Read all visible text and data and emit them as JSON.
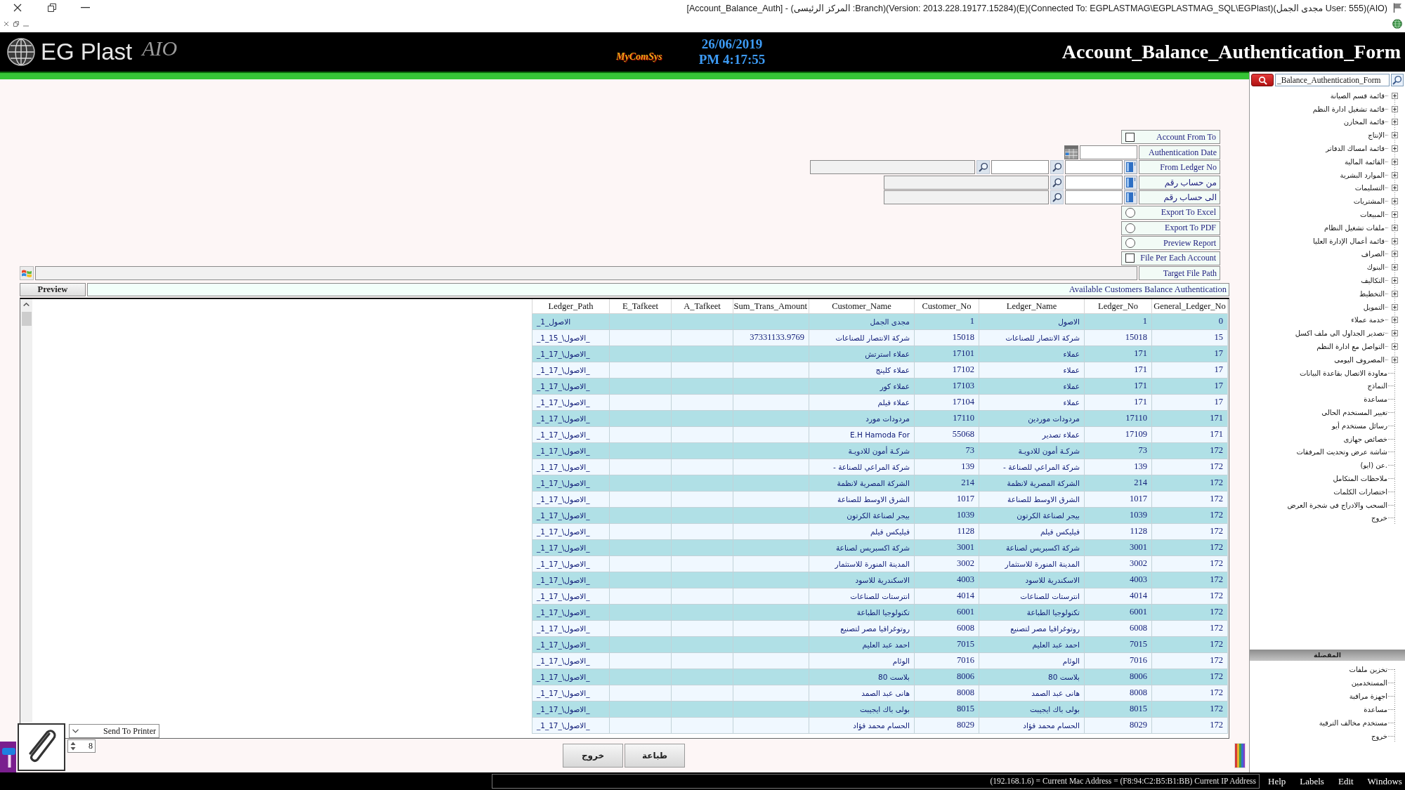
{
  "title_bar": {
    "title": "[Account_Balance_Auth] - (المركز الرئيسى :Branch)(Version: 2013.228.19177.15284)(E)(Connected To: EGPLASTMAG\\EGPLASTMAG_SQL\\EGPlast)(مجدى الجمل User: 555)(AIO)"
  },
  "header": {
    "brand": "EG Plast",
    "brand_suffix": "AIO",
    "vendor": "MyComSys",
    "date": "26/06/2019",
    "time": "PM 4:17:55",
    "form_title": "Account_Balance_Authentication_Form"
  },
  "form": {
    "rows": [
      {
        "kind": "checkbox",
        "label": "Account From To",
        "checked": false
      },
      {
        "kind": "date",
        "label": "Authentication Date"
      },
      {
        "kind": "multilookup",
        "label": "From Ledger No"
      },
      {
        "kind": "lookup",
        "label": "من حساب رقم"
      },
      {
        "kind": "lookup",
        "label": "الى حساب رقم"
      },
      {
        "kind": "radio",
        "label": "Export To Excel",
        "selected": false
      },
      {
        "kind": "radio",
        "label": "Export To PDF",
        "selected": false
      },
      {
        "kind": "radio",
        "label": "Preview Report",
        "selected": false
      },
      {
        "kind": "checkbox",
        "label": "File Per Each Account",
        "checked": false
      },
      {
        "kind": "path",
        "label": "Target File Path"
      }
    ]
  },
  "report": {
    "preview_button": "Preview",
    "caption": "Available Customers Balance Authentication",
    "columns": [
      "General_Ledger_No",
      "Ledger_No",
      "Ledger_Name",
      "Customer_No",
      "Customer_Name",
      "Sum_Trans_Amount",
      "A_Tafkeet",
      "E_Tafkeet",
      "Ledger_Path"
    ],
    "rows": [
      {
        "general_ledger_no": "0",
        "ledger_no": "1",
        "ledger_name": "الاصول",
        "customer_no": "1",
        "customer_name": "مجدى الجمل",
        "ledger_path": "_1_الاصول"
      },
      {
        "general_ledger_no": "15",
        "ledger_no": "15018",
        "ledger_name": "شركة الانتصار للصناعات",
        "customer_no": "15018",
        "customer_name": "شركة الانتصار للصناعات",
        "sum_trans_amount": "37331133.9769",
        "ledger_path": "_1_الاصول\\_15_"
      },
      {
        "general_ledger_no": "17",
        "ledger_no": "171",
        "ledger_name": "عملاء",
        "customer_no": "17101",
        "customer_name": "عملاء استرتش",
        "ledger_path": "_1_الاصول\\_17_"
      },
      {
        "general_ledger_no": "17",
        "ledger_no": "171",
        "ledger_name": "عملاء",
        "customer_no": "17102",
        "customer_name": "عملاء كلينج",
        "ledger_path": "_1_الاصول\\_17_"
      },
      {
        "general_ledger_no": "17",
        "ledger_no": "171",
        "ledger_name": "عملاء",
        "customer_no": "17103",
        "customer_name": "عملاء كور",
        "ledger_path": "_1_الاصول\\_17_"
      },
      {
        "general_ledger_no": "17",
        "ledger_no": "171",
        "ledger_name": "عملاء",
        "customer_no": "17104",
        "customer_name": "عملاء فيلم",
        "ledger_path": "_1_الاصول\\_17_"
      },
      {
        "general_ledger_no": "171",
        "ledger_no": "17110",
        "ledger_name": "مردودات موردين",
        "customer_no": "17110",
        "customer_name": "مردودات مورد",
        "ledger_path": "_1_الاصول\\_17_"
      },
      {
        "general_ledger_no": "171",
        "ledger_no": "17109",
        "ledger_name": "عملاء تصدير",
        "customer_no": "55068",
        "customer_name": "E.H Hamoda For",
        "ledger_path": "_1_الاصول\\_17_"
      },
      {
        "general_ledger_no": "172",
        "ledger_no": "73",
        "ledger_name": "شركـة أمون للادويـة",
        "customer_no": "73",
        "customer_name": "شركـة أمون للادويـة",
        "ledger_path": "_1_الاصول\\_17_"
      },
      {
        "general_ledger_no": "172",
        "ledger_no": "139",
        "ledger_name": "شركة المراعي للصناعة -",
        "customer_no": "139",
        "customer_name": "شركة المراعي للصناعة -",
        "ledger_path": "_1_الاصول\\_17_"
      },
      {
        "general_ledger_no": "172",
        "ledger_no": "214",
        "ledger_name": "الشركة المصرية لانظمة",
        "customer_no": "214",
        "customer_name": "الشركة المصرية لانظمة",
        "ledger_path": "_1_الاصول\\_17_"
      },
      {
        "general_ledger_no": "172",
        "ledger_no": "1017",
        "ledger_name": "الشرق الاوسط للصناعة",
        "customer_no": "1017",
        "customer_name": "الشرق الاوسط للصناعة",
        "ledger_path": "_1_الاصول\\_17_"
      },
      {
        "general_ledger_no": "172",
        "ledger_no": "1039",
        "ledger_name": "بيجر لصناعة الكرتون",
        "customer_no": "1039",
        "customer_name": "بيجر لصناعة الكرتون",
        "ledger_path": "_1_الاصول\\_17_"
      },
      {
        "general_ledger_no": "172",
        "ledger_no": "1128",
        "ledger_name": "فيليكس فيلم",
        "customer_no": "1128",
        "customer_name": "فيليكس فيلم",
        "ledger_path": "_1_الاصول\\_17_"
      },
      {
        "general_ledger_no": "172",
        "ledger_no": "3001",
        "ledger_name": "شركة اكسبريس لصناعة",
        "customer_no": "3001",
        "customer_name": "شركة اكسبريس لصناعة",
        "ledger_path": "_1_الاصول\\_17_"
      },
      {
        "general_ledger_no": "172",
        "ledger_no": "3002",
        "ledger_name": "المدينة المنورة للاستثمار",
        "customer_no": "3002",
        "customer_name": "المدينة المنورة للاستثمار",
        "ledger_path": "_1_الاصول\\_17_"
      },
      {
        "general_ledger_no": "172",
        "ledger_no": "4003",
        "ledger_name": "الاسكندرية للاسود",
        "customer_no": "4003",
        "customer_name": "الاسكندرية للاسود",
        "ledger_path": "_1_الاصول\\_17_"
      },
      {
        "general_ledger_no": "172",
        "ledger_no": "4014",
        "ledger_name": "انترستات للصناعات",
        "customer_no": "4014",
        "customer_name": "انترستات للصناعات",
        "ledger_path": "_1_الاصول\\_17_"
      },
      {
        "general_ledger_no": "172",
        "ledger_no": "6001",
        "ledger_name": "تكنولوجيا الطباعة",
        "customer_no": "6001",
        "customer_name": "تكنولوجيا الطباعة",
        "ledger_path": "_1_الاصول\\_17_"
      },
      {
        "general_ledger_no": "172",
        "ledger_no": "6008",
        "ledger_name": "روتوغرافيا مصر لتصنيع",
        "customer_no": "6008",
        "customer_name": "روتوغرافيا مصر لتصنيع",
        "ledger_path": "_1_الاصول\\_17_"
      },
      {
        "general_ledger_no": "172",
        "ledger_no": "7015",
        "ledger_name": "احمد عبد العليم",
        "customer_no": "7015",
        "customer_name": "احمد عبد العليم",
        "ledger_path": "_1_الاصول\\_17_"
      },
      {
        "general_ledger_no": "172",
        "ledger_no": "7016",
        "ledger_name": "الوئام",
        "customer_no": "7016",
        "customer_name": "الوئام",
        "ledger_path": "_1_الاصول\\_17_"
      },
      {
        "general_ledger_no": "172",
        "ledger_no": "8006",
        "ledger_name": "بلاست 80",
        "customer_no": "8006",
        "customer_name": "بلاست 80",
        "ledger_path": "_1_الاصول\\_17_"
      },
      {
        "general_ledger_no": "172",
        "ledger_no": "8008",
        "ledger_name": "هانى عبد الصمد",
        "customer_no": "8008",
        "customer_name": "هانى عبد الصمد",
        "ledger_path": "_1_الاصول\\_17_"
      },
      {
        "general_ledger_no": "172",
        "ledger_no": "8015",
        "ledger_name": "بولى باك ايجيبت",
        "customer_no": "8015",
        "customer_name": "بولى باك ايجيبت",
        "ledger_path": "_1_الاصول\\_17_"
      },
      {
        "general_ledger_no": "172",
        "ledger_no": "8029",
        "ledger_name": "الحسام محمد فؤاد",
        "customer_no": "8029",
        "customer_name": "الحسام محمد فؤاد",
        "ledger_path": "_1_الاصول\\_17_"
      }
    ]
  },
  "footer": {
    "printer": "Send To Printer",
    "copies": "8",
    "buttons": [
      "طباعة",
      "خروج"
    ]
  },
  "sidebar": {
    "search": {
      "value": "_Balance_Authentication_Form"
    },
    "tree": [
      {
        "kind": "group",
        "label": "قائمة قسم الصيانة",
        "expanded": false
      },
      {
        "kind": "group",
        "label": "قائمة تشغيل ادارة النظم",
        "expanded": false
      },
      {
        "kind": "group",
        "label": "قائمة المخازن",
        "expanded": false
      },
      {
        "kind": "group",
        "label": "الإنتاج",
        "expanded": false
      },
      {
        "kind": "group",
        "label": "قائمة امساك الدفاتر",
        "expanded": false
      },
      {
        "kind": "group",
        "label": "القائمة المالية",
        "expanded": false
      },
      {
        "kind": "group",
        "label": "الموارد البشرية",
        "expanded": false
      },
      {
        "kind": "group",
        "label": "التسليمات",
        "expanded": false
      },
      {
        "kind": "group",
        "label": "المشتريات",
        "expanded": false
      },
      {
        "kind": "group",
        "label": "المبيعات",
        "expanded": false
      },
      {
        "kind": "group",
        "label": "ملفات تشغيل النظام",
        "expanded": false
      },
      {
        "kind": "group",
        "label": "قائمة أعمال الإدارة العليا",
        "expanded": false
      },
      {
        "kind": "group",
        "label": "الصراف",
        "expanded": false
      },
      {
        "kind": "group",
        "label": "البنوك",
        "expanded": false
      },
      {
        "kind": "group",
        "label": "التكاليف",
        "expanded": false
      },
      {
        "kind": "group",
        "label": "التخطيط",
        "expanded": false
      },
      {
        "kind": "group",
        "label": "التمويل",
        "expanded": false
      },
      {
        "kind": "group",
        "label": "خدمة عملاء",
        "expanded": false
      },
      {
        "kind": "group",
        "label": "تصدير الجداول الى ملف اكسل",
        "expanded": false
      },
      {
        "kind": "group",
        "label": "التواصل مع ادارة النظم",
        "expanded": false
      },
      {
        "kind": "group",
        "label": "المصروف اليومى",
        "expanded": false
      },
      {
        "kind": "item",
        "label": "معاودة الاتصال بقاعدة البيانات"
      },
      {
        "kind": "item",
        "label": "النماذج"
      },
      {
        "kind": "item",
        "label": "مساعدة"
      },
      {
        "kind": "item",
        "label": "تغيير المستخدم الحالى"
      },
      {
        "kind": "item",
        "label": "رسائل مستخدم أيو"
      },
      {
        "kind": "item",
        "label": "خصائص جهازى"
      },
      {
        "kind": "item",
        "label": "شاشة عرض وتحديث المرفقات"
      },
      {
        "kind": "item",
        "label": "عن (ايو)."
      },
      {
        "kind": "item",
        "label": "ملاحظات المتكامل"
      },
      {
        "kind": "item",
        "label": "اختصارات الكلمات"
      },
      {
        "kind": "item",
        "label": "السحب والادراج فى شجرة العرض"
      },
      {
        "kind": "item",
        "label": "خروج"
      }
    ],
    "favorites": {
      "title": "المفضلة",
      "items": [
        "تخزين ملفات",
        "المستخدمين",
        "اجهزة مراقبة",
        "مساعدة",
        "مستخدم مخالف الترقية",
        "خروج"
      ]
    }
  },
  "status_bar": {
    "info": "(192.168.1.6) = Current Mac Address = (F8:94:C2:B5:B1:BB) Current IP Address",
    "menu": [
      "Windows",
      "Edit",
      "Labels",
      "Help"
    ]
  }
}
